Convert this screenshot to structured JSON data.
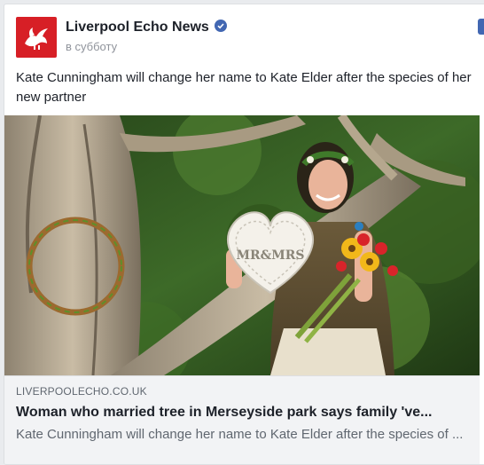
{
  "post": {
    "page_name": "Liverpool Echo News",
    "timestamp": "в субботу",
    "text": "Kate Cunningham will change her name to Kate Elder after the species of her new partner"
  },
  "photo": {
    "sign_text": "MR&MRS"
  },
  "link": {
    "domain": "LIVERPOOLECHO.CO.UK",
    "title": "Woman who married tree in Merseyside park says family 've...",
    "description": "Kate Cunningham will change her name to Kate Elder after the species of ..."
  },
  "colors": {
    "brand_red": "#d71f26",
    "facebook_blue": "#4267b2",
    "verified_badge": "#4267b2"
  },
  "icons": {
    "avatar": "liver-bird-logo",
    "verified": "verified-check-icon"
  }
}
